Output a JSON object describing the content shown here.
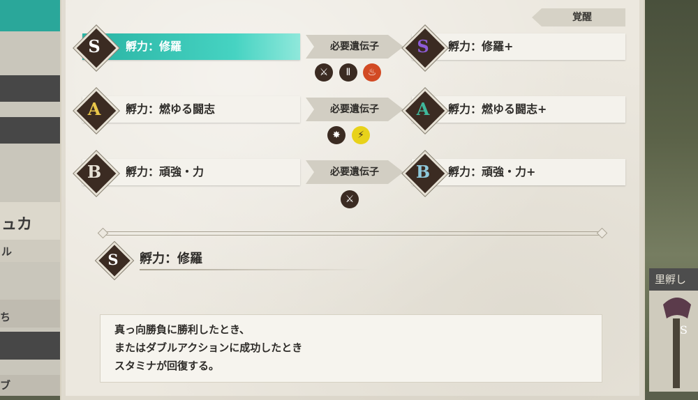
{
  "left_panel": {
    "frag_top": "ュカ",
    "frag_mid": "ル",
    "frag_a": "ち",
    "frag_b": "ブ"
  },
  "right_panel": {
    "card_title": "里孵し"
  },
  "header": {
    "awaken_tab_label": "覚醒"
  },
  "skills": [
    {
      "rank": "S",
      "name": "孵力：修羅",
      "gene_label": "必要遺伝子",
      "genes": [
        {
          "icon": "claw-icon",
          "glyph": "⚔",
          "color": "#3b2b22"
        },
        {
          "icon": "horn-icon",
          "glyph": "Ⅱ",
          "color": "#3b2b22"
        },
        {
          "icon": "fire-icon",
          "glyph": "♨",
          "color": "#d24a24"
        }
      ],
      "awakened_rank": "S",
      "awakened_name": "孵力：修羅+",
      "selected": true,
      "rank_color": "#ffffff",
      "awakened_rank_color": "#8d5cd6"
    },
    {
      "rank": "A",
      "name": "孵力：燃ゆる闘志",
      "gene_label": "必要遺伝子",
      "genes": [
        {
          "icon": "power-icon",
          "glyph": "✸",
          "color": "#3b2b22"
        },
        {
          "icon": "thunder-icon",
          "glyph": "⚡",
          "color": "#e8d21a"
        }
      ],
      "awakened_rank": "A",
      "awakened_name": "孵力：燃ゆる闘志+",
      "selected": false,
      "rank_color": "#e9c64a",
      "awakened_rank_color": "#3fb89b"
    },
    {
      "rank": "B",
      "name": "孵力：頑強・力",
      "gene_label": "必要遺伝子",
      "genes": [
        {
          "icon": "claw-icon",
          "glyph": "⚔",
          "color": "#3b2b22"
        }
      ],
      "awakened_rank": "B",
      "awakened_name": "孵力：頑強・力+",
      "selected": false,
      "rank_color": "#e7e2d6",
      "awakened_rank_color": "#8fc9dc"
    }
  ],
  "detail": {
    "rank": "S",
    "title": "孵力：修羅",
    "description": [
      "真っ向勝負に勝利したとき、",
      "またはダブルアクションに成功したとき",
      "スタミナが回復する。"
    ]
  }
}
